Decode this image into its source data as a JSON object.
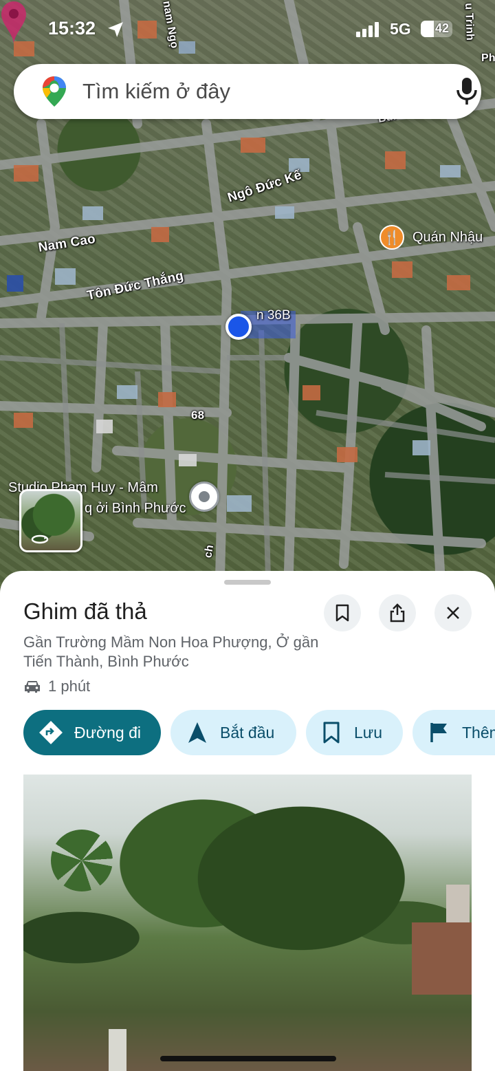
{
  "status_bar": {
    "time": "15:32",
    "network": "5G",
    "battery_level": "42",
    "battery_fraction": 0.42
  },
  "search": {
    "placeholder": "Tìm kiếm ở đây",
    "logo_icon": "google-maps-pin-icon",
    "mic_icon": "microphone-icon"
  },
  "map": {
    "road_labels": [
      "Ngô Đức Kế",
      "Nam Cao",
      "Tôn Đức Thắng",
      "68",
      "nam Ngọ",
      "u Trinh",
      "Bùi",
      "ch",
      "Ph"
    ],
    "pin_label": "n 36B",
    "poi_restaurant": "Quán Nhậu",
    "poi_studio_line1": "Studio Phạm Huy - Mâm",
    "poi_studio_line2": "q       ởi Bình Phước"
  },
  "place": {
    "title": "Ghim đã thả",
    "address": "Gần Trường Mầm Non Hoa Phượng, Ở gần Tiến Thành, Bình Phước",
    "drive_time": "1 phút",
    "actions": {
      "directions": "Đường đi",
      "start": "Bắt đầu",
      "save": "Lưu",
      "more": "Thêm"
    }
  },
  "colors": {
    "primary_chip": "#0d6f80",
    "secondary_chip": "#d9f1fb",
    "location_dot": "#1a56e8",
    "restaurant_marker": "#ef8c2a"
  }
}
